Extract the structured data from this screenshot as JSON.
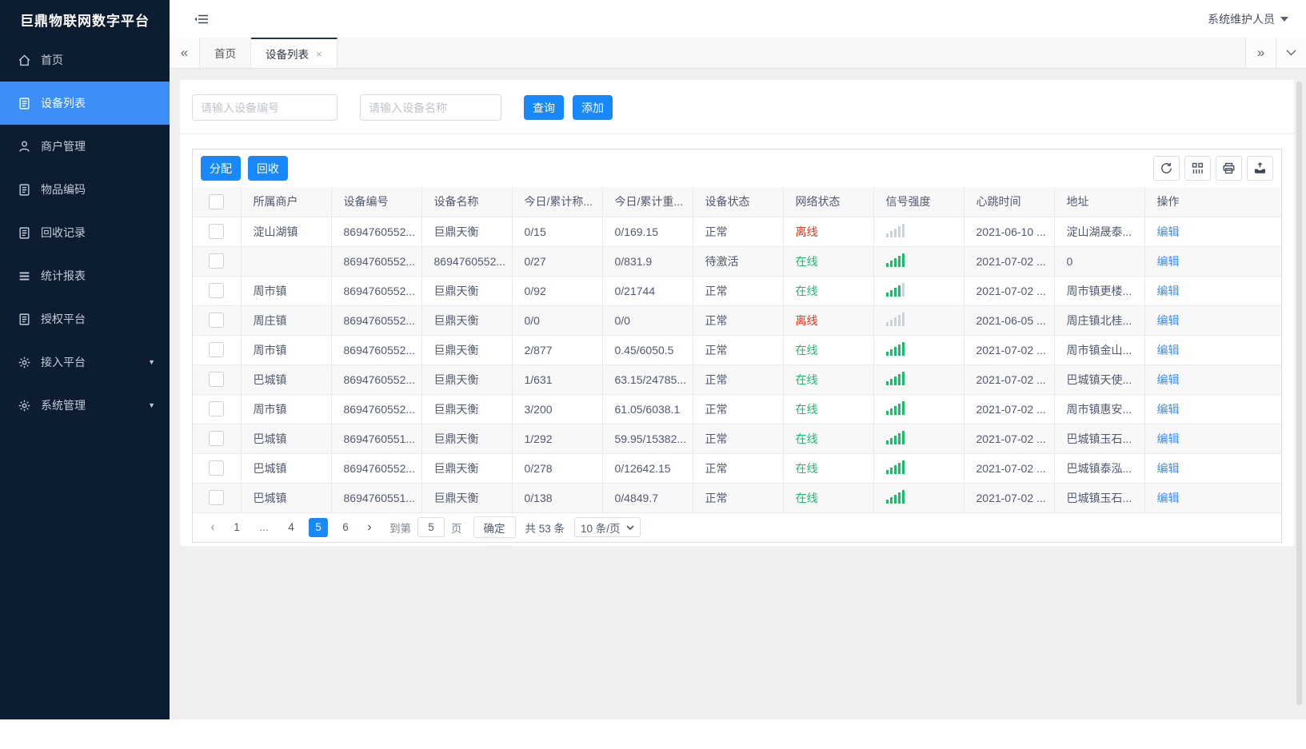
{
  "sidebar": {
    "title": "巨鼎物联网数字平台",
    "items": [
      {
        "key": "home",
        "label": "首页",
        "icon": "home-icon",
        "active": false,
        "has_arrow": false
      },
      {
        "key": "device-list",
        "label": "设备列表",
        "icon": "device-list-icon",
        "active": true,
        "has_arrow": false
      },
      {
        "key": "merchant-mgmt",
        "label": "商户管理",
        "icon": "user-icon",
        "active": false,
        "has_arrow": false
      },
      {
        "key": "item-code",
        "label": "物品编码",
        "icon": "clipboard-icon",
        "active": false,
        "has_arrow": false
      },
      {
        "key": "recycle-record",
        "label": "回收记录",
        "icon": "clipboard-icon",
        "active": false,
        "has_arrow": false
      },
      {
        "key": "stats-report",
        "label": "统计报表",
        "icon": "list-icon",
        "active": false,
        "has_arrow": false
      },
      {
        "key": "auth-platform",
        "label": "授权平台",
        "icon": "clipboard-icon",
        "active": false,
        "has_arrow": false
      },
      {
        "key": "access-platform",
        "label": "接入平台",
        "icon": "gear-icon",
        "active": false,
        "has_arrow": true
      },
      {
        "key": "system-mgmt",
        "label": "系统管理",
        "icon": "gear-icon",
        "active": false,
        "has_arrow": true
      }
    ]
  },
  "topbar": {
    "user_label": "系统维护人员"
  },
  "tabbar": {
    "tabs": [
      {
        "label": "首页",
        "active": false,
        "closable": false
      },
      {
        "label": "设备列表",
        "active": true,
        "closable": true
      }
    ],
    "close_glyph": "×",
    "left_glyph": "«",
    "right_glyph": "»"
  },
  "search": {
    "device_no_placeholder": "请输入设备编号",
    "device_name_placeholder": "请输入设备名称",
    "query_label": "查询",
    "add_label": "添加"
  },
  "panel": {
    "assign_label": "分配",
    "recycle_label": "回收",
    "tool_icons": [
      "refresh-icon",
      "columns-icon",
      "print-icon",
      "export-icon"
    ]
  },
  "table": {
    "headers": [
      "所属商户",
      "设备编号",
      "设备名称",
      "今日/累计称...",
      "今日/累计重...",
      "设备状态",
      "网络状态",
      "信号强度",
      "心跳时间",
      "地址",
      "操作"
    ],
    "edit_label": "编辑",
    "rows": [
      {
        "merchant": "淀山湖镇",
        "device_no": "8694760552...",
        "device_name": "巨鼎天衡",
        "today_count": "0/15",
        "today_weight": "0/169.15",
        "status": "正常",
        "network": "离线",
        "online": false,
        "signal_green": 0,
        "heartbeat": "2021-06-10 ...",
        "address": "淀山湖晟泰..."
      },
      {
        "merchant": "",
        "device_no": "8694760552...",
        "device_name": "8694760552...",
        "today_count": "0/27",
        "today_weight": "0/831.9",
        "status": "待激活",
        "network": "在线",
        "online": true,
        "signal_green": 5,
        "heartbeat": "2021-07-02 ...",
        "address": "0"
      },
      {
        "merchant": "周市镇",
        "device_no": "8694760552...",
        "device_name": "巨鼎天衡",
        "today_count": "0/92",
        "today_weight": "0/21744",
        "status": "正常",
        "network": "在线",
        "online": true,
        "signal_green": 4,
        "heartbeat": "2021-07-02 ...",
        "address": "周市镇更楼..."
      },
      {
        "merchant": "周庄镇",
        "device_no": "8694760552...",
        "device_name": "巨鼎天衡",
        "today_count": "0/0",
        "today_weight": "0/0",
        "status": "正常",
        "network": "离线",
        "online": false,
        "signal_green": 0,
        "heartbeat": "2021-06-05 ...",
        "address": "周庄镇北桂..."
      },
      {
        "merchant": "周市镇",
        "device_no": "8694760552...",
        "device_name": "巨鼎天衡",
        "today_count": "2/877",
        "today_weight": "0.45/6050.5",
        "status": "正常",
        "network": "在线",
        "online": true,
        "signal_green": 5,
        "heartbeat": "2021-07-02 ...",
        "address": "周市镇金山..."
      },
      {
        "merchant": "巴城镇",
        "device_no": "8694760552...",
        "device_name": "巨鼎天衡",
        "today_count": "1/631",
        "today_weight": "63.15/24785...",
        "status": "正常",
        "network": "在线",
        "online": true,
        "signal_green": 5,
        "heartbeat": "2021-07-02 ...",
        "address": "巴城镇天使..."
      },
      {
        "merchant": "周市镇",
        "device_no": "8694760552...",
        "device_name": "巨鼎天衡",
        "today_count": "3/200",
        "today_weight": "61.05/6038.1",
        "status": "正常",
        "network": "在线",
        "online": true,
        "signal_green": 5,
        "heartbeat": "2021-07-02 ...",
        "address": "周市镇惠安..."
      },
      {
        "merchant": "巴城镇",
        "device_no": "8694760551...",
        "device_name": "巨鼎天衡",
        "today_count": "1/292",
        "today_weight": "59.95/15382...",
        "status": "正常",
        "network": "在线",
        "online": true,
        "signal_green": 5,
        "heartbeat": "2021-07-02 ...",
        "address": "巴城镇玉石..."
      },
      {
        "merchant": "巴城镇",
        "device_no": "8694760552...",
        "device_name": "巨鼎天衡",
        "today_count": "0/278",
        "today_weight": "0/12642.15",
        "status": "正常",
        "network": "在线",
        "online": true,
        "signal_green": 5,
        "heartbeat": "2021-07-02 ...",
        "address": "巴城镇泰泓..."
      },
      {
        "merchant": "巴城镇",
        "device_no": "8694760551...",
        "device_name": "巨鼎天衡",
        "today_count": "0/138",
        "today_weight": "0/4849.7",
        "status": "正常",
        "network": "在线",
        "online": true,
        "signal_green": 5,
        "heartbeat": "2021-07-02 ...",
        "address": "巴城镇玉石..."
      }
    ]
  },
  "pagination": {
    "prev_glyph": "‹",
    "next_glyph": "›",
    "pages": [
      "1",
      "...",
      "4",
      "5",
      "6"
    ],
    "active_page": "5",
    "goto_label": "到第",
    "goto_value": "5",
    "unit_label": "页",
    "confirm_label": "确定",
    "total_label": "共 53 条",
    "page_size_label": "10 条/页"
  },
  "colors": {
    "sidebar_bg": "#0d1d31",
    "active_menu_blue": "#3d8ff7",
    "accent_blue": "#1789fd",
    "link_blue": "#3d8ef6",
    "online_green": "#19be6b",
    "offline_red": "#ed2f14"
  }
}
